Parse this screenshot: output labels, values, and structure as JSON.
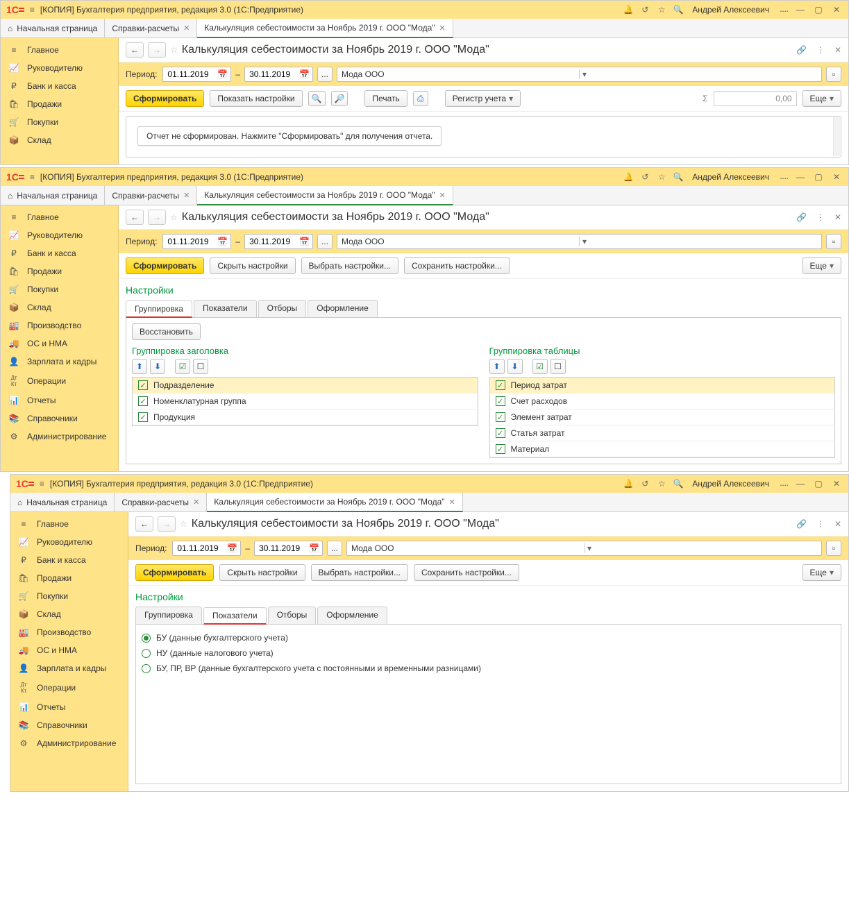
{
  "app_title": "[КОПИЯ] Бухгалтерия предприятия, редакция 3.0  (1С:Предприятие)",
  "user": "Андрей Алексеевич",
  "tabs": {
    "home": "Начальная страница",
    "ref": "Справки-расчеты",
    "calc": "Калькуляция себестоимости за Ноябрь 2019 г. ООО \"Мода\""
  },
  "sidebar_short": [
    {
      "label": "Главное",
      "icon": "menu"
    },
    {
      "label": "Руководителю",
      "icon": "chart"
    },
    {
      "label": "Банк и касса",
      "icon": "ruble"
    },
    {
      "label": "Продажи",
      "icon": "bag"
    },
    {
      "label": "Покупки",
      "icon": "cart"
    },
    {
      "label": "Склад",
      "icon": "box"
    }
  ],
  "sidebar_full": [
    {
      "label": "Главное",
      "icon": "menu"
    },
    {
      "label": "Руководителю",
      "icon": "chart"
    },
    {
      "label": "Банк и касса",
      "icon": "ruble"
    },
    {
      "label": "Продажи",
      "icon": "bag"
    },
    {
      "label": "Покупки",
      "icon": "cart"
    },
    {
      "label": "Склад",
      "icon": "box"
    },
    {
      "label": "Производство",
      "icon": "factory"
    },
    {
      "label": "ОС и НМА",
      "icon": "truck"
    },
    {
      "label": "Зарплата и кадры",
      "icon": "person"
    },
    {
      "label": "Операции",
      "icon": "ops"
    },
    {
      "label": "Отчеты",
      "icon": "bars"
    },
    {
      "label": "Справочники",
      "icon": "books"
    },
    {
      "label": "Администрирование",
      "icon": "gear"
    }
  ],
  "page_title": "Калькуляция себестоимости за Ноябрь 2019 г. ООО \"Мода\"",
  "period_label": "Период:",
  "date_from": "01.11.2019",
  "date_to": "30.11.2019",
  "ellipsis": "...",
  "org": "Мода ООО",
  "btn_form": "Сформировать",
  "btn_show_settings": "Показать настройки",
  "btn_hide_settings": "Скрыть настройки",
  "btn_choose_settings": "Выбрать настройки...",
  "btn_save_settings": "Сохранить настройки...",
  "btn_print": "Печать",
  "btn_register": "Регистр учета",
  "sum_value": "0,00",
  "btn_more": "Еще",
  "report_msg": "Отчет не сформирован. Нажмите \"Сформировать\" для получения отчета.",
  "settings_title": "Настройки",
  "subtabs": {
    "group": "Группировка",
    "indicators": "Показатели",
    "filters": "Отборы",
    "format": "Оформление"
  },
  "btn_restore": "Восстановить",
  "group_header_title": "Группировка заголовка",
  "group_table_title": "Группировка таблицы",
  "group_header_items": [
    "Подразделение",
    "Номенклатурная группа",
    "Продукция"
  ],
  "group_table_items": [
    "Период затрат",
    "Счет расходов",
    "Элемент затрат",
    "Статья затрат",
    "Материал"
  ],
  "radios": [
    {
      "label": "БУ (данные бухгалтерского учета)",
      "checked": true
    },
    {
      "label": "НУ (данные налогового учета)",
      "checked": false
    },
    {
      "label": "БУ, ПР, ВР (данные бухгалтерского учета с постоянными и временными разницами)",
      "checked": false
    }
  ]
}
